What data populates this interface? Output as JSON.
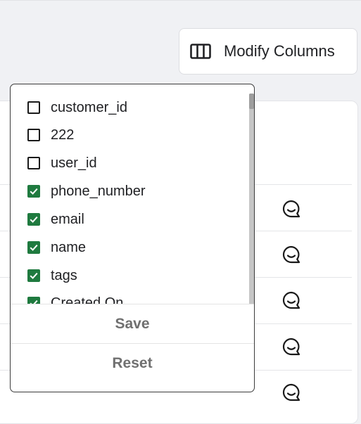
{
  "toolbar": {
    "modify_columns_label": "Modify Columns"
  },
  "column_picker": {
    "options": [
      {
        "label": "customer_id",
        "checked": false
      },
      {
        "label": "222",
        "checked": false
      },
      {
        "label": "user_id",
        "checked": false
      },
      {
        "label": "phone_number",
        "checked": true
      },
      {
        "label": "email",
        "checked": true
      },
      {
        "label": "name",
        "checked": true
      },
      {
        "label": "tags",
        "checked": true
      },
      {
        "label": "Created On",
        "checked": true
      }
    ],
    "save_label": "Save",
    "reset_label": "Reset"
  },
  "table": {
    "row_action_icon": "chat-bubble-icon",
    "visible_row_count": 5
  },
  "colors": {
    "checked": "#1f7a3f",
    "background": "#f0f1f4"
  }
}
